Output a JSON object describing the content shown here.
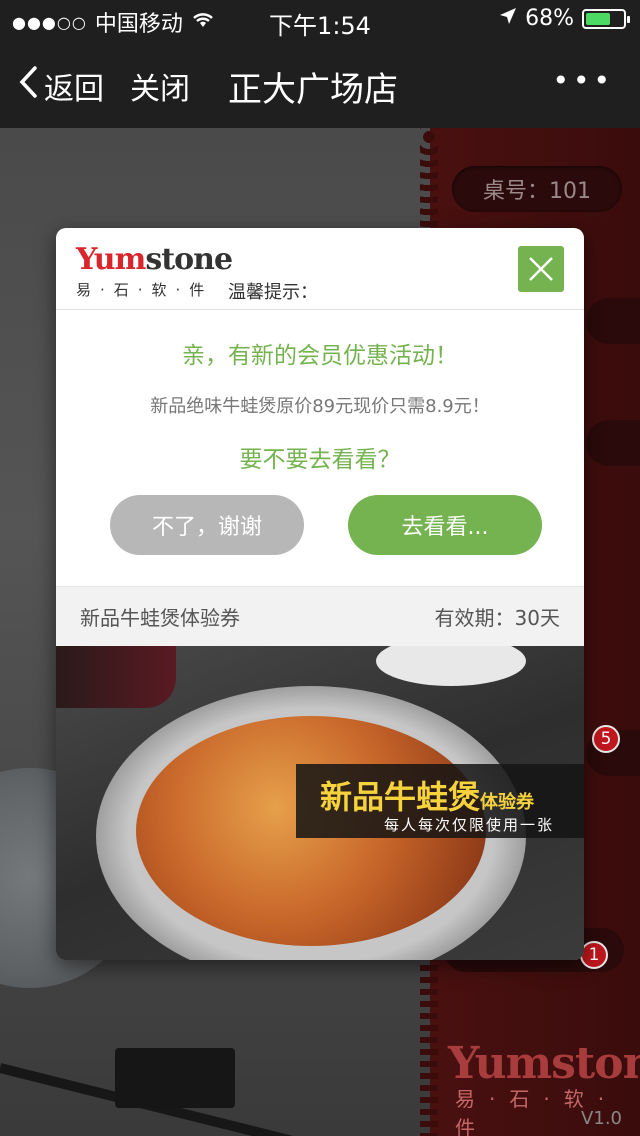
{
  "status": {
    "carrier": "中国移动",
    "signal_dots": "●●●○○",
    "time": "下午1:54",
    "battery_percent": "68%",
    "battery_level": 0.68
  },
  "nav": {
    "back_label": "返回",
    "close_label": "关闭",
    "title": "正大广场店",
    "more_label": "•••"
  },
  "background": {
    "table_label": "桌号：101",
    "badge_1": "5",
    "badge_2": "1",
    "brand_name": "Yumstone",
    "brand_sub": "易·石·软·件",
    "version": "V1.0"
  },
  "dialog": {
    "logo_y": "Yum",
    "logo_s": "stone",
    "logo_sub": "易·石·软·件",
    "tip_label": "温馨提示：",
    "promo_title": "亲，有新的会员优惠活动！",
    "promo_desc": "新品绝味牛蛙煲原价89元现价只需8.9元！",
    "promo_ask": "要不要去看看？",
    "btn_no": "不了，谢谢",
    "btn_go": "去看看...",
    "voucher_name": "新品牛蛙煲体验券",
    "voucher_validity": "有效期：30天",
    "banner_title": "新品牛蛙煲",
    "banner_suffix": "体验券",
    "banner_sub": "每人每次仅限使用一张"
  },
  "colors": {
    "accent_green": "#74b34f",
    "brand_red": "#d8262c",
    "badge_red": "#c0161d"
  }
}
